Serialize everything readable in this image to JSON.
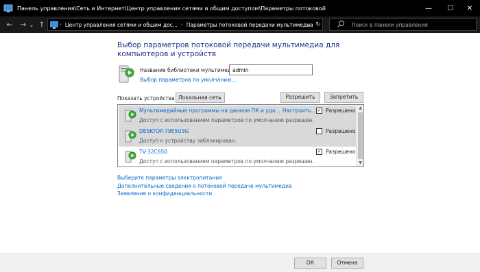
{
  "window": {
    "title": "Панель управления\\Сеть и Интернет\\Центр управления сетями и общим доступом\\Параметры потоковой",
    "minimize": "—",
    "maximize": "☐",
    "close": "✕"
  },
  "nav": {
    "back": "←",
    "forward": "→",
    "recent": "⌄",
    "up": "↑",
    "path_separator": "›",
    "path_dropdown": "⌄",
    "refresh": "↻"
  },
  "address": {
    "segments": [
      "Центр управления сетями и общим дос...",
      "Параметры потоковой передачи мультимедиа"
    ]
  },
  "search": {
    "placeholder": "Поиск в панели управления",
    "icon": "magnifier-icon"
  },
  "main": {
    "heading": "Выбор параметров потоковой передачи мультимедиа для компьютеров и устройств",
    "library_label": "Название библиотеки мультимедиа:",
    "library_name": "admin",
    "defaults_link": "Выбор параметров по умолчанию...",
    "show_devices_label": "Показать устройства на:",
    "show_devices_value": "Локальная сеть",
    "allow_all": "Разрешить все",
    "block_all": "Запретить все"
  },
  "devices": [
    {
      "name": "Мультимедийные программы на данном ПК и удаленных...",
      "description": "Доступ с использованием параметров по умолчанию разрешен.",
      "config": "Настроить...",
      "allowed": true,
      "allow_label": "Разрешено"
    },
    {
      "name": "DESKTOP-79E5U3G",
      "description": "Доступ к устройству заблокирован.",
      "config": "",
      "allowed": false,
      "allow_label": "Разрешено"
    },
    {
      "name": "TV-32C650",
      "description": "Доступ с использованием параметров по умолчанию разрешен.",
      "config": "",
      "allowed": true,
      "allow_label": "Разрешено"
    }
  ],
  "links": {
    "power": "Выберите параметры электропитания",
    "more_info": "Дополнительные сведения о потоковой передаче мультимедиа",
    "privacy": "Заявление о конфиденциальности"
  },
  "footer": {
    "ok": "ОК",
    "cancel": "Отмена"
  },
  "colors": {
    "titlebar": "#000000",
    "link": "#0066cc",
    "heading": "#1e3287",
    "selected_row": "#d9d9d9"
  }
}
